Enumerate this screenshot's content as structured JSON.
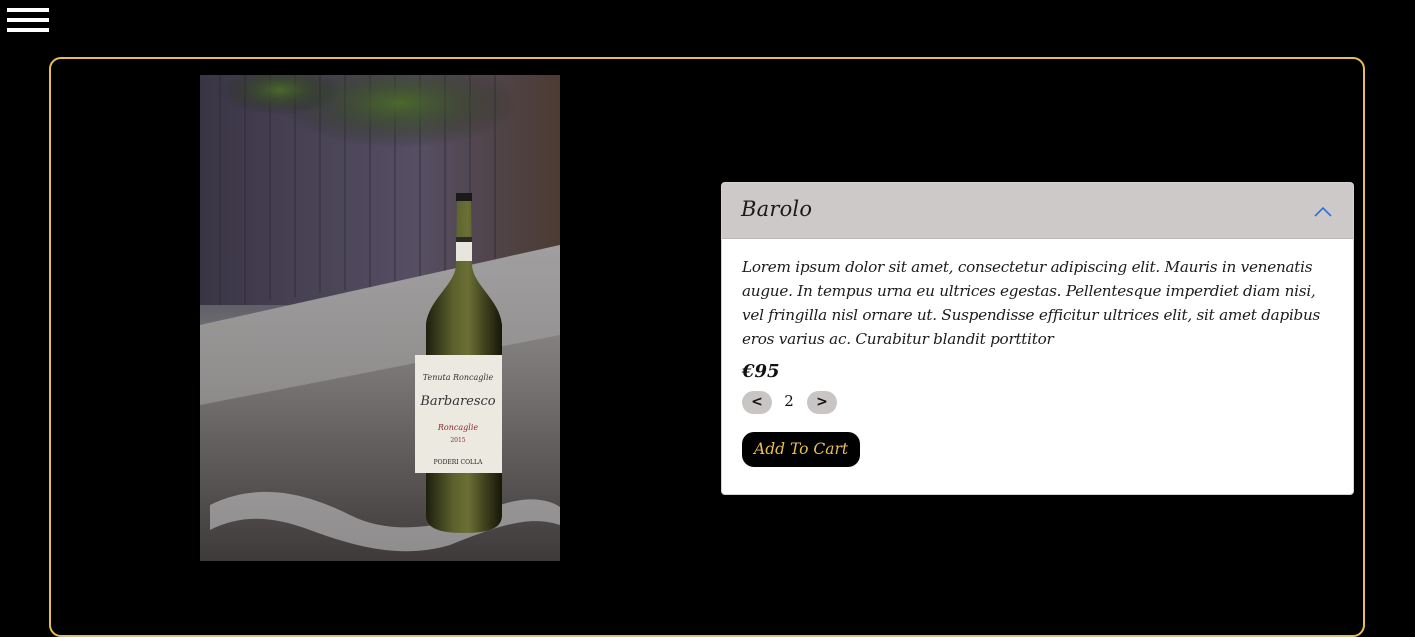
{
  "nav": {
    "menu_icon": "hamburger-menu-icon"
  },
  "colors": {
    "background": "#000000",
    "frame_border": "#e8bf55",
    "accordion_header": "#cdc9c9",
    "chevron": "#2f6fd8",
    "button_text": "#e8bf55"
  },
  "product": {
    "image_description_icon": "wine-bottle-photo",
    "title": "Barolo",
    "description": "Lorem ipsum dolor sit amet, consectetur adipiscing elit. Mauris in venenatis augue. In tempus urna eu ultrices egestas. Pellentesque imperdiet diam nisi, vel fringilla nisl ornare ut. Suspendisse efficitur ultrices elit, sit amet dapibus eros varius ac. Curabitur blandit porttitor",
    "price": "€95",
    "quantity": {
      "decrement_label": "<",
      "value": "2",
      "increment_label": ">"
    },
    "add_to_cart_label": "Add To Cart",
    "label_text": {
      "line1": "Tenuta Roncaglie",
      "line2": "Barbaresco",
      "line3": "Roncaglie",
      "line4": "2015",
      "line5": "PODERI COLLA"
    }
  }
}
